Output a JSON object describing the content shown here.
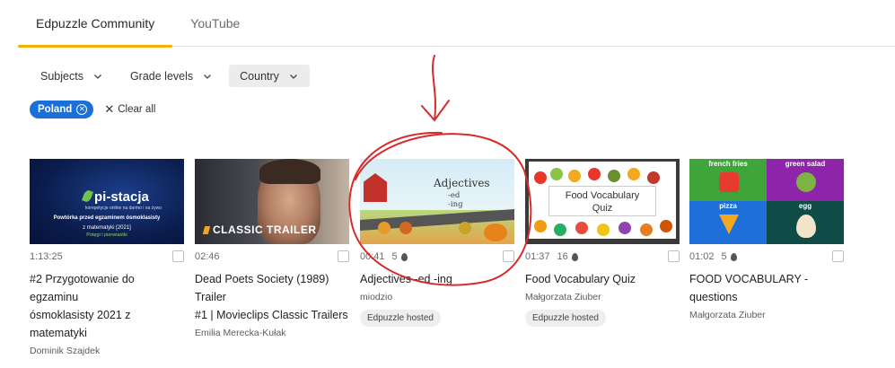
{
  "tabs": [
    {
      "label": "Edpuzzle Community",
      "active": true
    },
    {
      "label": "YouTube",
      "active": false
    }
  ],
  "filters": [
    {
      "label": "Subjects",
      "selected": false
    },
    {
      "label": "Grade levels",
      "selected": false
    },
    {
      "label": "Country",
      "selected": true
    }
  ],
  "active_filters": {
    "chips": [
      {
        "label": "Poland"
      }
    ],
    "clear_label": "Clear all"
  },
  "colors": {
    "accent": "#f4b000",
    "chip": "#1a6fd9",
    "annotation": "#d92a2a"
  },
  "videos": [
    {
      "duration": "1:13:25",
      "uses": "",
      "title_lines": [
        "#2 Przygotowanie do egzaminu",
        "ósmoklasisty 2021 z matematyki"
      ],
      "author": "Dominik Szajdek",
      "hosted": "",
      "thumb": {
        "brand": "pi-stacja",
        "tagline": "korepetycje online na darmo i na żywo",
        "line1": "Powtórka przed egzaminem ósmoklasisty",
        "line2": "z matematyki [2021]",
        "line3": "Potęgi i pierwiastki"
      }
    },
    {
      "duration": "02:46",
      "uses": "",
      "title_lines": [
        "Dead Poets Society (1989) Trailer",
        "#1 | Movieclips Classic Trailers"
      ],
      "author": "Emilia Merecka-Kułak",
      "hosted": "",
      "thumb": {
        "banner": "CLASSIC TRAILER"
      }
    },
    {
      "duration": "00:41",
      "uses": "5",
      "title_lines": [
        "Adjectives -ed -ing"
      ],
      "author": "miodzio",
      "hosted": "Edpuzzle hosted",
      "thumb": {
        "heading": "Adjectives",
        "sub1": "-ed",
        "sub2": "-ing"
      }
    },
    {
      "duration": "01:37",
      "uses": "16",
      "title_lines": [
        "Food Vocabulary Quiz"
      ],
      "author": "Małgorzata Ziuber",
      "hosted": "Edpuzzle hosted",
      "thumb": {
        "line1": "Food Vocabulary",
        "line2": "Quiz"
      }
    },
    {
      "duration": "01:02",
      "uses": "5",
      "title_lines": [
        "FOOD VOCABULARY - questions"
      ],
      "author": "Małgorzata Ziuber",
      "hosted": "",
      "thumb": {
        "q1": "french fries",
        "q2": "green salad",
        "q3": "pizza",
        "q4": "egg"
      }
    }
  ]
}
